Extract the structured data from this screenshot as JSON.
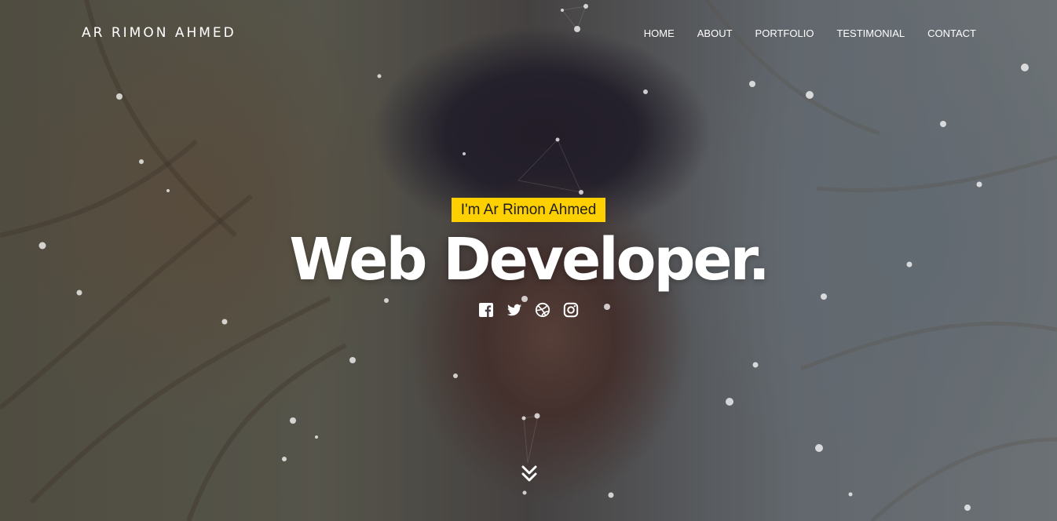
{
  "brand": "AR RIMON AHMED",
  "nav": [
    "HOME",
    "ABOUT",
    "PORTFOLIO",
    "TESTIMONIAL",
    "CONTACT"
  ],
  "hero": {
    "tagline": "I'm Ar Rimon Ahmed",
    "headline": "Web Developer."
  },
  "social": [
    "facebook-icon",
    "twitter-icon",
    "dribbble-icon",
    "instagram-icon"
  ],
  "scroll_icon": "double-chevron-down-icon",
  "colors": {
    "accent": "#ffd000",
    "text": "#ffffff",
    "tagline_text": "#1e1e1e"
  }
}
